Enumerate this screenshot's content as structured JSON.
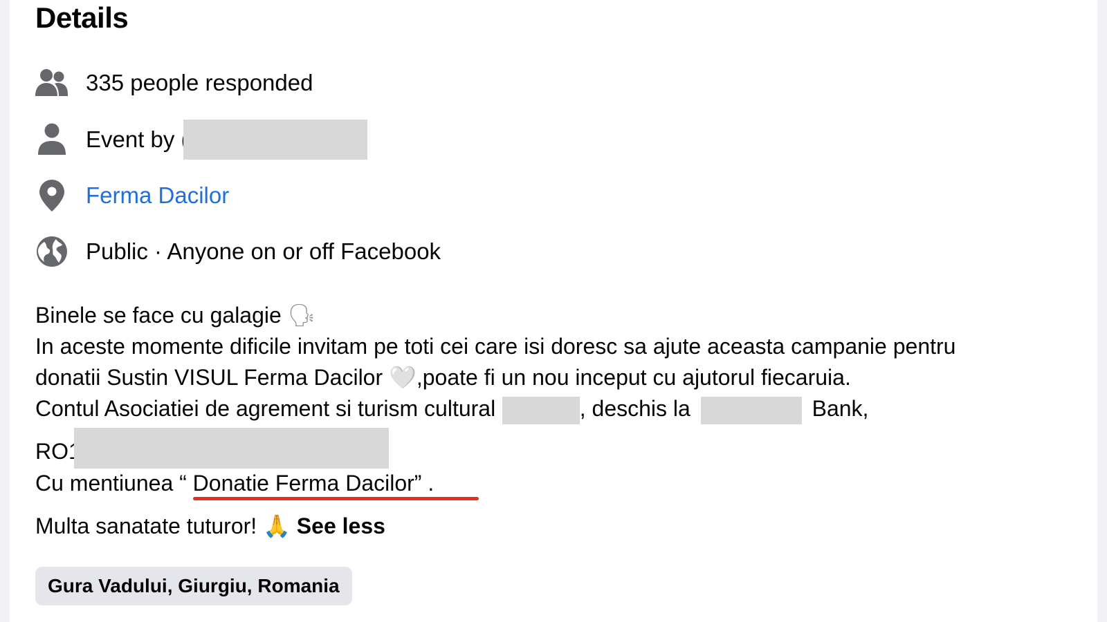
{
  "details": {
    "title": "Details",
    "responded": "335 people responded",
    "event_by_prefix": "Event by (",
    "location": "Ferma Dacilor",
    "privacy": "Public · Anyone on or off Facebook"
  },
  "description": {
    "line1": "Binele se face cu galagie",
    "line1_emoji": "🗣",
    "line2": "In aceste momente dificile invitam pe toti cei care isi doresc sa ajute aceasta campanie pentru",
    "line3_a": "donatii Sustin VISUL Ferma Dacilor",
    "line3_emoji": "🤍",
    "line3_b": ",poate fi un nou inceput cu ajutorul fiecaruia.",
    "line4_a": "Contul Asociatiei de agrement si turism cultural (",
    "line4_b": ", deschis la",
    "line4_c": "Bank,",
    "line5": "RO1",
    "line6_a": "Cu mentiunea",
    "line6_b": "“ Donatie Ferma Dacilor” .",
    "line7": "Multa sanatate tuturor!",
    "line7_emoji": "🙏",
    "see_less": "See less"
  },
  "location_chip": "Gura Vadului, Giurgiu, Romania",
  "colors": {
    "link": "#216fdb",
    "icon": "#65676b",
    "underline": "#e3301f",
    "chip_bg": "#e4e6eb"
  }
}
